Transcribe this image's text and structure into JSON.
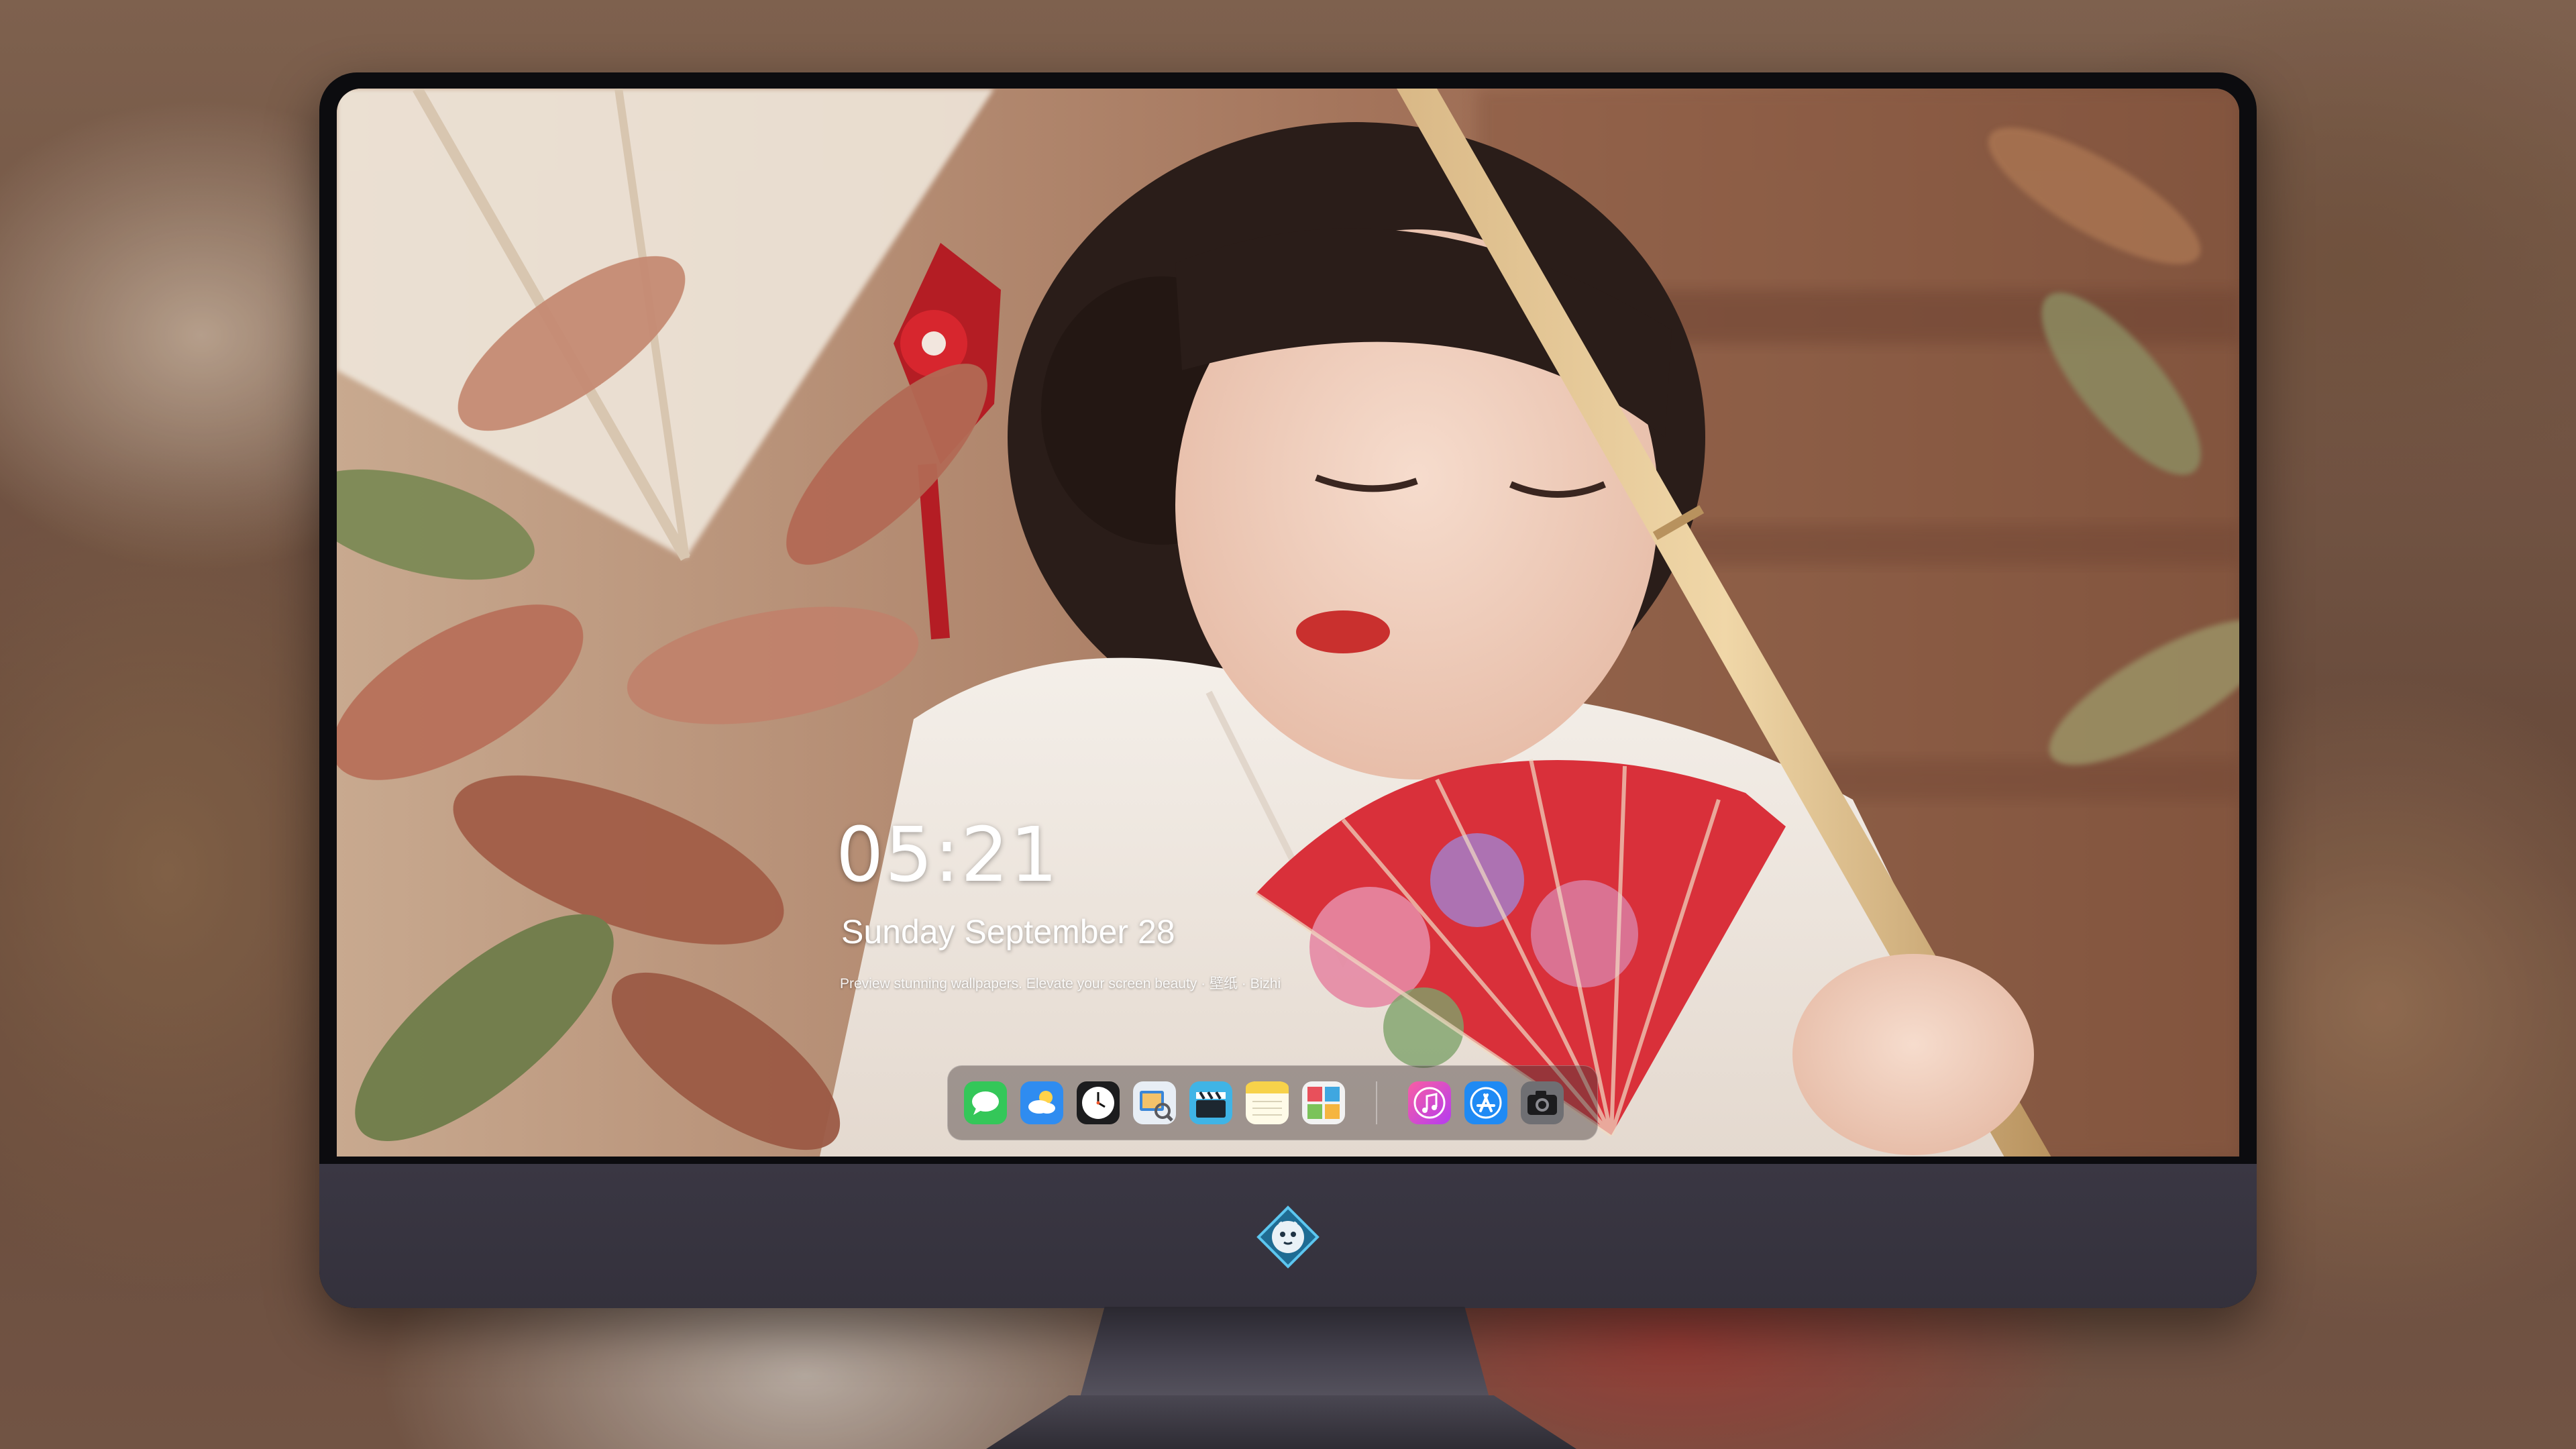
{
  "lock_screen": {
    "time": "05:21",
    "date": "Sunday September  28",
    "tagline": "Preview stunning wallpapers. Elevate your screen beauty · 壁纸 · Bizhi"
  },
  "dock": {
    "apps": [
      {
        "name": "messages",
        "icon": "messages-icon",
        "color": "#34c759"
      },
      {
        "name": "weather",
        "icon": "weather-icon",
        "color": "#2f8cf0"
      },
      {
        "name": "clock",
        "icon": "clock-icon",
        "color": "#1c1c1e"
      },
      {
        "name": "preview",
        "icon": "preview-icon",
        "color": "#3a86d8"
      },
      {
        "name": "clips",
        "icon": "clapperboard-icon",
        "color": "#3fb4e6"
      },
      {
        "name": "notes",
        "icon": "notes-icon",
        "color": "#f7d24a"
      },
      {
        "name": "photo-booth",
        "icon": "photo-booth-icon",
        "color": "#e8505b"
      },
      {
        "name": "music",
        "icon": "music-icon",
        "color": "#e93da7"
      },
      {
        "name": "app-store",
        "icon": "app-store-icon",
        "color": "#1f8af4"
      },
      {
        "name": "camera",
        "icon": "camera-icon",
        "color": "#6f6f73"
      }
    ]
  },
  "colors": {
    "monitor_bezel": "#0c0c0f",
    "monitor_chin": "#3a3743",
    "text": "#ffffff"
  }
}
